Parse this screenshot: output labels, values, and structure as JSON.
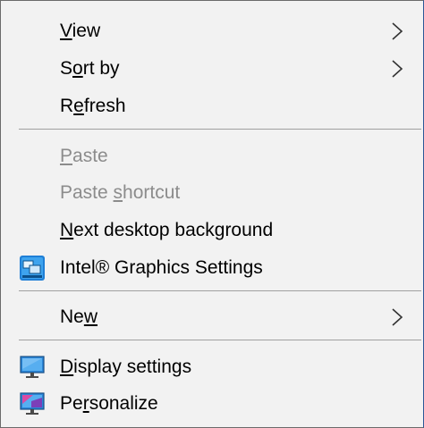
{
  "menu": {
    "items": [
      {
        "id": "view",
        "pre": "",
        "u": "V",
        "post": "iew",
        "submenu": true,
        "disabled": false
      },
      {
        "id": "sort-by",
        "pre": "S",
        "u": "o",
        "post": "rt by",
        "submenu": true,
        "disabled": false
      },
      {
        "id": "refresh",
        "pre": "R",
        "u": "e",
        "post": "fresh",
        "submenu": false,
        "disabled": false
      },
      {
        "id": "paste",
        "pre": "",
        "u": "P",
        "post": "aste",
        "submenu": false,
        "disabled": true
      },
      {
        "id": "paste-shortcut",
        "pre": "Paste ",
        "u": "s",
        "post": "hortcut",
        "submenu": false,
        "disabled": true
      },
      {
        "id": "next-desktop-background",
        "pre": "",
        "u": "N",
        "post": "ext desktop background",
        "submenu": false,
        "disabled": false
      },
      {
        "id": "intel-graphics-settings",
        "pre": "Intel® Graphics Settings",
        "u": "",
        "post": "",
        "submenu": false,
        "disabled": false,
        "icon": "intel-graphics-icon"
      },
      {
        "id": "new",
        "pre": "Ne",
        "u": "w",
        "post": "",
        "submenu": true,
        "disabled": false
      },
      {
        "id": "display-settings",
        "pre": "",
        "u": "D",
        "post": "isplay settings",
        "submenu": false,
        "disabled": false,
        "icon": "monitor-icon"
      },
      {
        "id": "personalize",
        "pre": "Pe",
        "u": "r",
        "post": "sonalize",
        "submenu": false,
        "disabled": false,
        "icon": "personalize-monitor-icon"
      }
    ]
  },
  "colors": {
    "background": "#f2f2f2",
    "disabled_text": "#8c8c8c",
    "separator": "#a0a0a0"
  }
}
